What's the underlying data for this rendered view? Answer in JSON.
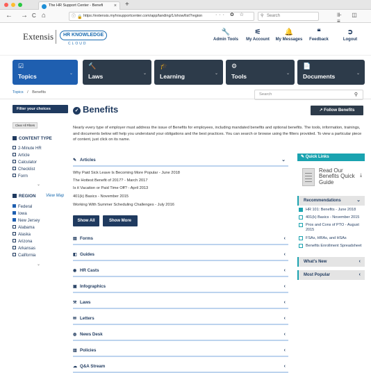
{
  "browser": {
    "tab_title": "The HR Support Center - Benefi",
    "tab_close": "×",
    "new_tab": "+",
    "url": "https://extensis.myhrsupportcenter.com/app/landing/1/show/list?region",
    "url_ellipsis": "··· ✿ ☆",
    "search_placeholder": "Search",
    "back": "←",
    "forward": "→",
    "reload": "C",
    "home": "⌂",
    "right_tools": "⊪ ◫ ≡"
  },
  "header": {
    "logo_text": "Extensis",
    "logo_badge": "HR KNOWLEDGE",
    "logo_sub": "CLOUD",
    "nav": [
      {
        "label": "Admin Tools",
        "icon": "wrench-icon",
        "glyph": "🔧"
      },
      {
        "label": "My Account",
        "icon": "sliders-icon",
        "glyph": "⚟"
      },
      {
        "label": "My Messages",
        "icon": "bell-icon",
        "glyph": "🔔"
      },
      {
        "label": "Feedback",
        "icon": "quote-icon",
        "glyph": "❝"
      },
      {
        "label": "Logout",
        "icon": "logout-icon",
        "glyph": "➲"
      }
    ]
  },
  "mega_nav": [
    {
      "label": "Topics",
      "glyph": "☑",
      "color": "#1f5fb0"
    },
    {
      "label": "Laws",
      "glyph": "🔨",
      "color": "#2d3b4a"
    },
    {
      "label": "Learning",
      "glyph": "🎓",
      "color": "#2d3b4a"
    },
    {
      "label": "Tools",
      "glyph": "⚙",
      "color": "#2d3b4a"
    },
    {
      "label": "Documents",
      "glyph": "📄",
      "color": "#2d3b4a"
    }
  ],
  "breadcrumb": {
    "root": "Topics",
    "sep": "/",
    "current": "Benefits"
  },
  "site_search": {
    "placeholder": "Search",
    "icon": "⚲"
  },
  "sidebar": {
    "filter_label": "Filter your choices",
    "clear_label": "Clear All Filters",
    "content_type_label": "CONTENT TYPE",
    "content_types": [
      "2-Minute HR",
      "Article",
      "Calculator",
      "Checklist",
      "Form"
    ],
    "more_glyph": "⌄",
    "region_label": "REGION",
    "view_map": "View Map",
    "regions": [
      {
        "label": "Federal",
        "checked": true
      },
      {
        "label": "Iowa",
        "checked": true
      },
      {
        "label": "New Jersey",
        "checked": true
      },
      {
        "label": "Alabama",
        "checked": false
      },
      {
        "label": "Alaska",
        "checked": false
      },
      {
        "label": "Arizona",
        "checked": false
      },
      {
        "label": "Arkansas",
        "checked": false
      },
      {
        "label": "California",
        "checked": false
      }
    ]
  },
  "main": {
    "title": "Benefits",
    "title_icon": "✓",
    "follow_label": "↗ Follow Benefits",
    "intro": "Nearly every type of employer must address the issue of Benefits for employees, including mandated benefits and optional benefits. The tools, information, trainings, and documents below will help you understand your obligations and the best practices. You can search or browse using the filters provided. To view a particular piece of content, just click on its name.",
    "articles_label": "Articles",
    "articles": [
      "Why Paid Sick Leave Is Becoming More Popular - June 2018",
      "The Hottest Benefit of 2017? - March 2017",
      "Is it Vacation or Paid Time Off? - April 2013",
      "401(k) Basics - November 2015",
      "Working With Summer Scheduling Challenges - July 2016"
    ],
    "show_all": "Show All",
    "show_more": "Show More",
    "sections": [
      {
        "label": "Forms",
        "glyph": "▤"
      },
      {
        "label": "Guides",
        "glyph": "◧"
      },
      {
        "label": "HR Casts",
        "glyph": "◉"
      },
      {
        "label": "Infographics",
        "glyph": "▣"
      },
      {
        "label": "Laws",
        "glyph": "⚒"
      },
      {
        "label": "Letters",
        "glyph": "✉"
      },
      {
        "label": "News Desk",
        "glyph": "◍"
      },
      {
        "label": "Policies",
        "glyph": "▥"
      },
      {
        "label": "Q&A Stream",
        "glyph": "☁"
      }
    ],
    "open_chevron": "⌄",
    "closed_chevron": "‹"
  },
  "right": {
    "quick_links_label": "✎ Quick Links",
    "quick_doc_title": "Read Our Benefits Quick Guide",
    "download_glyph": "⤓",
    "recommendations_label": "Recommendations",
    "recommendations": [
      {
        "label": "HR 101: Benefits - June 2018",
        "type": "video"
      },
      {
        "label": "401(k) Basics - November 2015",
        "type": "doc"
      },
      {
        "label": "Pros and Cons of PTO - August 2015",
        "type": "doc"
      },
      {
        "label": "FSAs, HRAs, and HSAs",
        "type": "doc"
      },
      {
        "label": "Benefits Enrollment Spreadsheet",
        "type": "doc"
      }
    ],
    "whats_new_label": "What's New",
    "most_popular_label": "Most Popular",
    "open_chevron": "⌄",
    "closed_chevron": "‹"
  },
  "colors": {
    "navy": "#1f3a5f",
    "blue": "#1f5fb0",
    "teal": "#1aa3b0"
  }
}
